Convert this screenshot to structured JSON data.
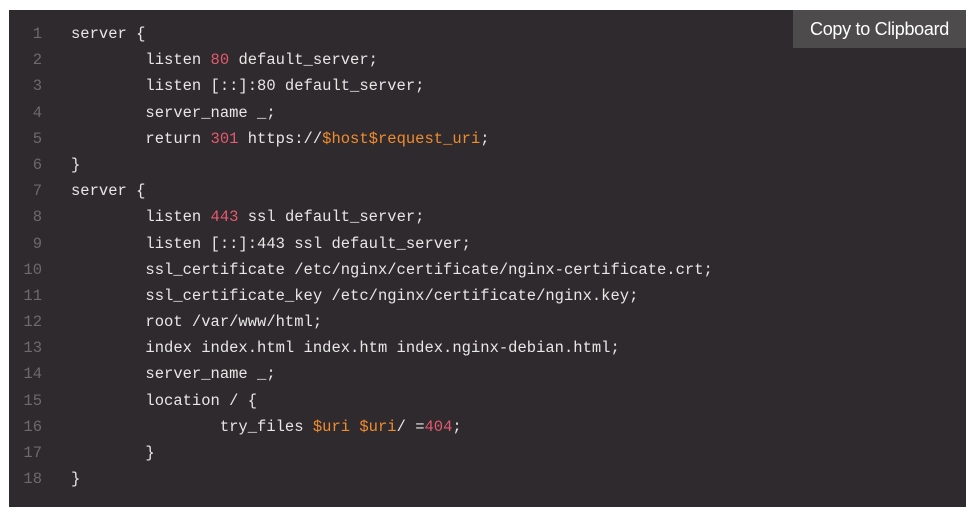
{
  "toolbar": {
    "copy_label": "Copy to Clipboard"
  },
  "colors": {
    "background": "#2f2a2d",
    "text": "#e8e6e7",
    "line_number": "#6c6a6b",
    "number": "#e25a6f",
    "variable": "#f08c2f",
    "button_bg": "#4d4b4c"
  },
  "code": {
    "language": "nginx",
    "lines": [
      {
        "n": "1",
        "segments": [
          {
            "t": "server {",
            "c": "text"
          }
        ]
      },
      {
        "n": "2",
        "segments": [
          {
            "t": "        listen ",
            "c": "text"
          },
          {
            "t": "80",
            "c": "number"
          },
          {
            "t": " default_server;",
            "c": "text"
          }
        ]
      },
      {
        "n": "3",
        "segments": [
          {
            "t": "        listen [::]:80 default_server;",
            "c": "text"
          }
        ]
      },
      {
        "n": "4",
        "segments": [
          {
            "t": "        server_name _;",
            "c": "text"
          }
        ]
      },
      {
        "n": "5",
        "segments": [
          {
            "t": "        return ",
            "c": "text"
          },
          {
            "t": "301",
            "c": "number"
          },
          {
            "t": " https://",
            "c": "text"
          },
          {
            "t": "$host$request_uri",
            "c": "variable"
          },
          {
            "t": ";",
            "c": "text"
          }
        ]
      },
      {
        "n": "6",
        "segments": [
          {
            "t": "}",
            "c": "text"
          }
        ]
      },
      {
        "n": "7",
        "segments": [
          {
            "t": "server {",
            "c": "text"
          }
        ]
      },
      {
        "n": "8",
        "segments": [
          {
            "t": "        listen ",
            "c": "text"
          },
          {
            "t": "443",
            "c": "number"
          },
          {
            "t": " ssl default_server;",
            "c": "text"
          }
        ]
      },
      {
        "n": "9",
        "segments": [
          {
            "t": "        listen [::]:443 ssl default_server;",
            "c": "text"
          }
        ]
      },
      {
        "n": "10",
        "segments": [
          {
            "t": "        ssl_certificate /etc/nginx/certificate/nginx-certificate.crt;",
            "c": "text"
          }
        ]
      },
      {
        "n": "11",
        "segments": [
          {
            "t": "        ssl_certificate_key /etc/nginx/certificate/nginx.key;",
            "c": "text"
          }
        ]
      },
      {
        "n": "12",
        "segments": [
          {
            "t": "        root /var/www/html;",
            "c": "text"
          }
        ]
      },
      {
        "n": "13",
        "segments": [
          {
            "t": "        index index.html index.htm index.nginx-debian.html;",
            "c": "text"
          }
        ]
      },
      {
        "n": "14",
        "segments": [
          {
            "t": "        server_name _;",
            "c": "text"
          }
        ]
      },
      {
        "n": "15",
        "segments": [
          {
            "t": "        location / {",
            "c": "text"
          }
        ]
      },
      {
        "n": "16",
        "segments": [
          {
            "t": "                try_files ",
            "c": "text"
          },
          {
            "t": "$uri",
            "c": "variable"
          },
          {
            "t": " ",
            "c": "text"
          },
          {
            "t": "$uri",
            "c": "variable"
          },
          {
            "t": "/ =",
            "c": "text"
          },
          {
            "t": "404",
            "c": "number"
          },
          {
            "t": ";",
            "c": "text"
          }
        ]
      },
      {
        "n": "17",
        "segments": [
          {
            "t": "        }",
            "c": "text"
          }
        ]
      },
      {
        "n": "18",
        "segments": [
          {
            "t": "}",
            "c": "text"
          }
        ]
      }
    ]
  }
}
